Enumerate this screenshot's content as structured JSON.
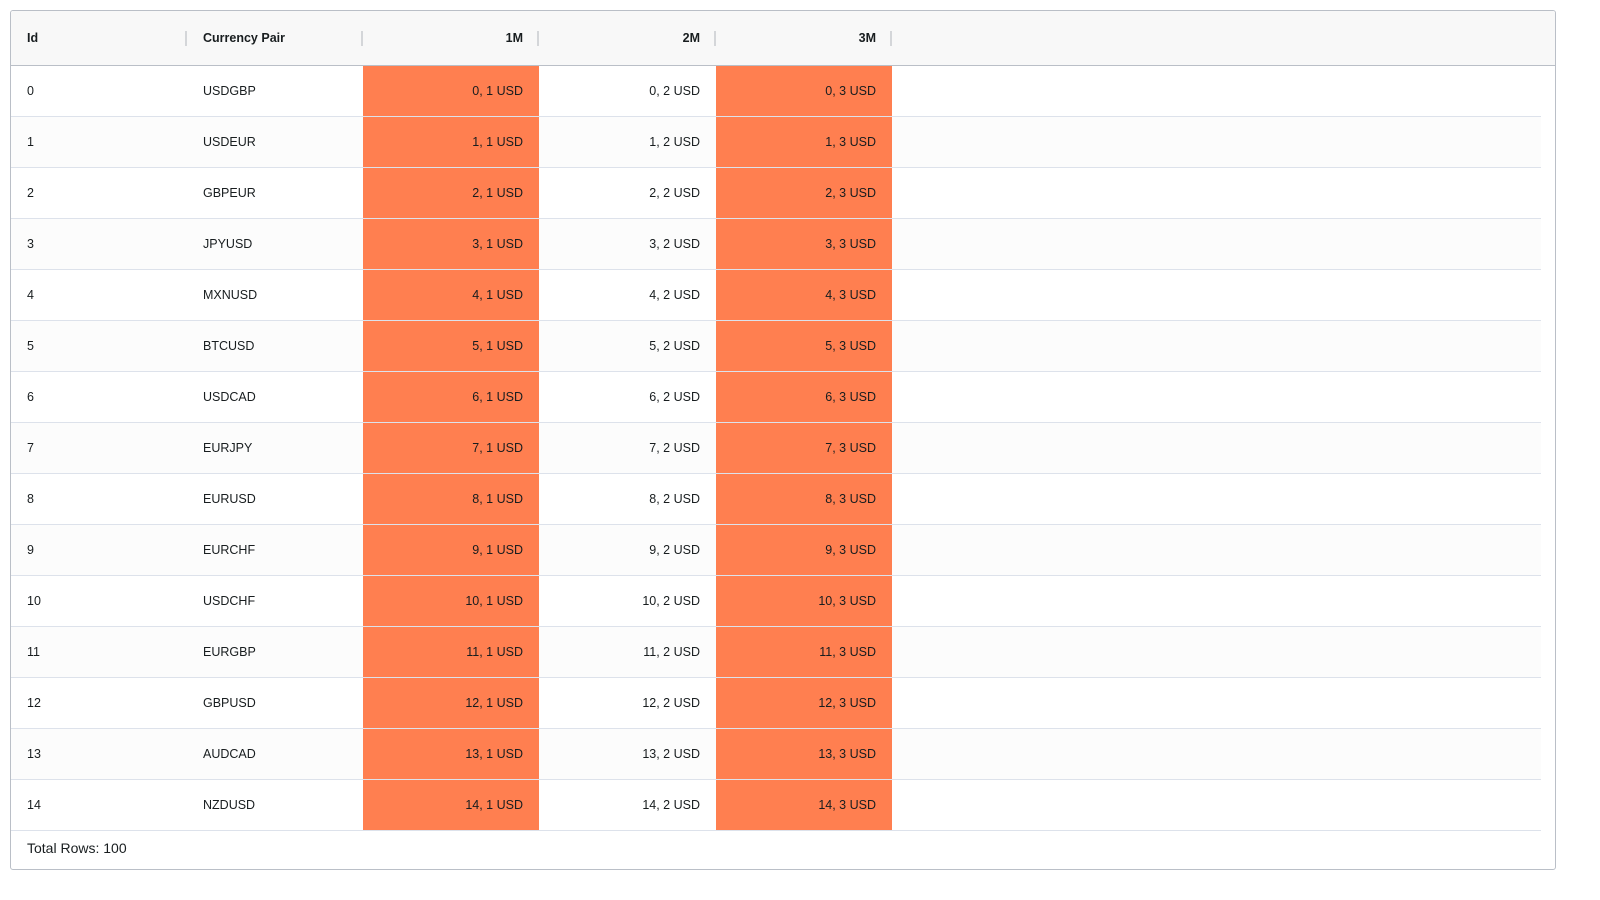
{
  "columns": [
    {
      "label": "Id",
      "align": "left"
    },
    {
      "label": "Currency Pair",
      "align": "left"
    },
    {
      "label": "1M",
      "align": "right"
    },
    {
      "label": "2M",
      "align": "right"
    },
    {
      "label": "3M",
      "align": "right"
    }
  ],
  "highlight_color": "#ff7f50",
  "highlight_columns": [
    2,
    4
  ],
  "rows": [
    [
      "0",
      "USDGBP",
      "0, 1 USD",
      "0, 2 USD",
      "0, 3 USD"
    ],
    [
      "1",
      "USDEUR",
      "1, 1 USD",
      "1, 2 USD",
      "1, 3 USD"
    ],
    [
      "2",
      "GBPEUR",
      "2, 1 USD",
      "2, 2 USD",
      "2, 3 USD"
    ],
    [
      "3",
      "JPYUSD",
      "3, 1 USD",
      "3, 2 USD",
      "3, 3 USD"
    ],
    [
      "4",
      "MXNUSD",
      "4, 1 USD",
      "4, 2 USD",
      "4, 3 USD"
    ],
    [
      "5",
      "BTCUSD",
      "5, 1 USD",
      "5, 2 USD",
      "5, 3 USD"
    ],
    [
      "6",
      "USDCAD",
      "6, 1 USD",
      "6, 2 USD",
      "6, 3 USD"
    ],
    [
      "7",
      "EURJPY",
      "7, 1 USD",
      "7, 2 USD",
      "7, 3 USD"
    ],
    [
      "8",
      "EURUSD",
      "8, 1 USD",
      "8, 2 USD",
      "8, 3 USD"
    ],
    [
      "9",
      "EURCHF",
      "9, 1 USD",
      "9, 2 USD",
      "9, 3 USD"
    ],
    [
      "10",
      "USDCHF",
      "10, 1 USD",
      "10, 2 USD",
      "10, 3 USD"
    ],
    [
      "11",
      "EURGBP",
      "11, 1 USD",
      "11, 2 USD",
      "11, 3 USD"
    ],
    [
      "12",
      "GBPUSD",
      "12, 1 USD",
      "12, 2 USD",
      "12, 3 USD"
    ],
    [
      "13",
      "AUDCAD",
      "13, 1 USD",
      "13, 2 USD",
      "13, 3 USD"
    ],
    [
      "14",
      "NZDUSD",
      "14, 1 USD",
      "14, 2 USD",
      "14, 3 USD"
    ]
  ],
  "footer": {
    "total_rows_text": "Total Rows: 100"
  }
}
